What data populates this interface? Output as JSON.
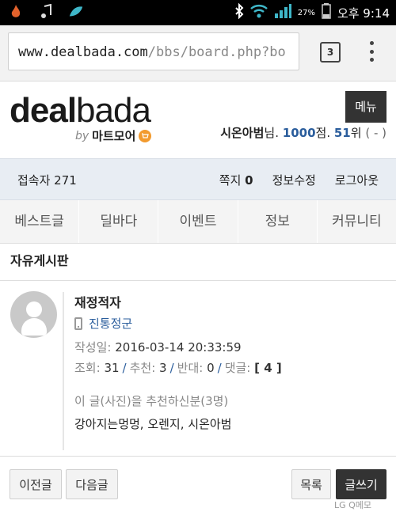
{
  "status_bar": {
    "battery_percent": "27%",
    "time": "오후 9:14",
    "icons": [
      "flame-icon",
      "music-note-icon",
      "leaf-icon",
      "bluetooth-icon",
      "wifi-icon",
      "signal-icon",
      "battery-icon"
    ]
  },
  "browser": {
    "url_main": "www.dealbada.com",
    "url_rest": "/bbs/board.php?bo",
    "tab_count": "3"
  },
  "header": {
    "logo_deal": "deal",
    "logo_bada": "bada",
    "by": "by",
    "brand": "마트모어",
    "menu_label": "메뉴",
    "user_name": "시온아범",
    "user_suffix": "님.",
    "points": "1000",
    "points_unit": "점.",
    "rank": "51",
    "rank_unit": "위",
    "rank_change": "( - )"
  },
  "infobar": {
    "visitors": "접속자 271",
    "messages_label": "쪽지",
    "messages_count": "0",
    "edit_info": "정보수정",
    "logout": "로그아웃"
  },
  "nav": {
    "items": [
      "베스트글",
      "딜바다",
      "이벤트",
      "정보",
      "커뮤니티"
    ]
  },
  "board": {
    "title": "자유게시판"
  },
  "post": {
    "title": "재정적자",
    "author": "진통정군",
    "date_label": "작성일:",
    "date": "2016-03-14 20:33:59",
    "views_label": "조회:",
    "views": "31",
    "recommend_label": "추천:",
    "recommend": "3",
    "oppose_label": "반대:",
    "oppose": "0",
    "comments_label": "댓글:",
    "comments": "[ 4 ]",
    "recommenders_label": "이 글(사진)을 추천하신분(3명)",
    "recommenders": "강아지는멍멍, 오렌지, 시온아범"
  },
  "buttons": {
    "prev": "이전글",
    "next": "다음글",
    "list": "목록",
    "write": "글쓰기"
  },
  "watermark": "LG Q메모",
  "colors": {
    "accent_blue": "#2a5d9c",
    "dark_button": "#333333",
    "info_bar_bg": "#e8edf3"
  }
}
